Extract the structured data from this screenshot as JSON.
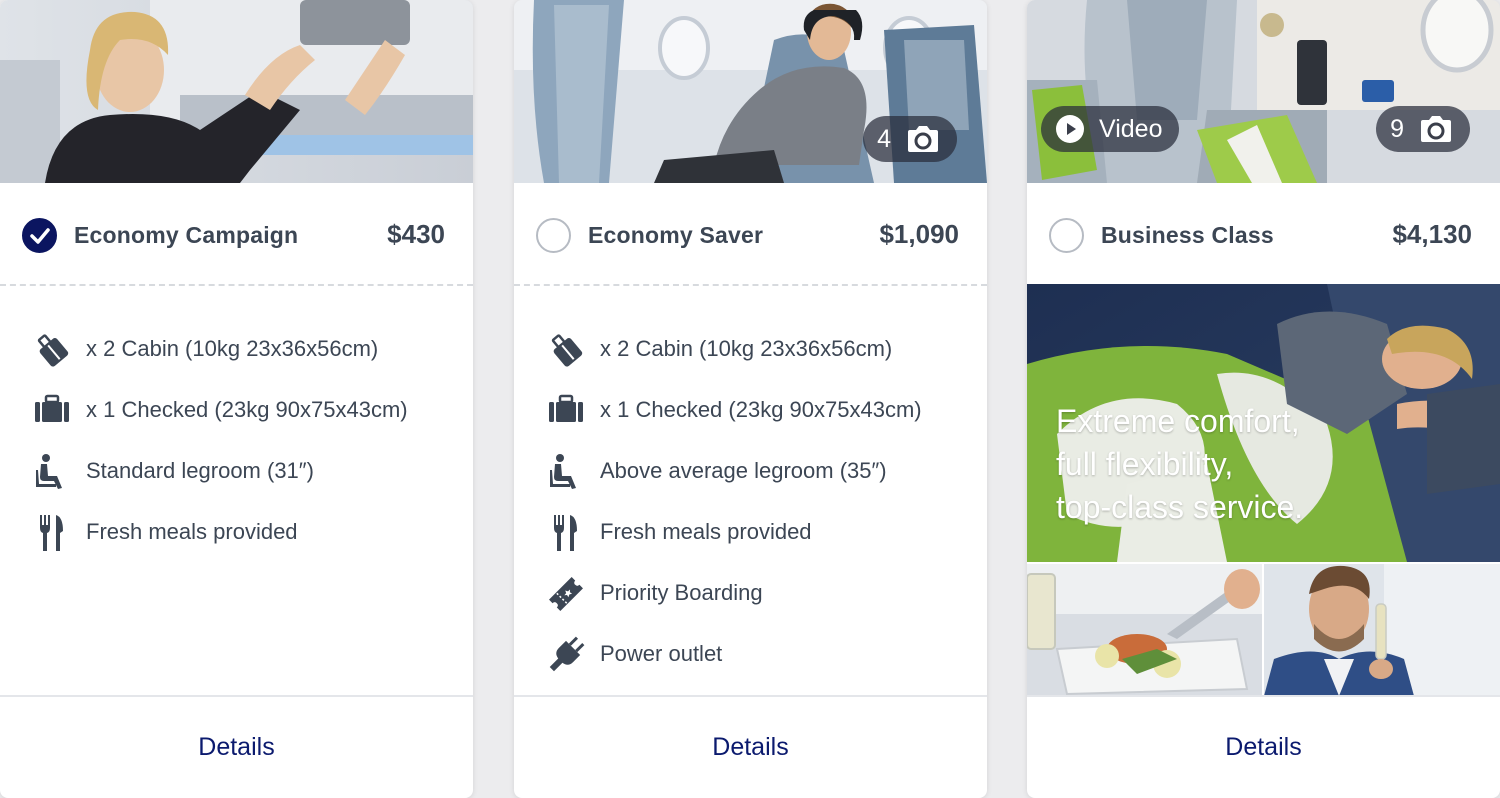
{
  "colors": {
    "navy": "#0b1560",
    "text": "#3c4654",
    "link": "#0b1a6e"
  },
  "cards": [
    {
      "name": "Economy Campaign",
      "price": "$430",
      "selected": true,
      "features": [
        {
          "icon": "cabin-bag-icon",
          "text": "x 2 Cabin (10kg 23x36x56cm)"
        },
        {
          "icon": "checked-bag-icon",
          "text": "x 1 Checked (23kg 90x75x43cm)"
        },
        {
          "icon": "seat-legroom-icon",
          "text": "Standard legroom (31″)"
        },
        {
          "icon": "meal-icon",
          "text": "Fresh meals provided"
        }
      ],
      "details_label": "Details"
    },
    {
      "name": "Economy Saver",
      "price": "$1,090",
      "selected": false,
      "photo_count": "4",
      "features": [
        {
          "icon": "cabin-bag-icon",
          "text": "x 2 Cabin (10kg 23x36x56cm)"
        },
        {
          "icon": "checked-bag-icon",
          "text": "x 1 Checked (23kg 90x75x43cm)"
        },
        {
          "icon": "seat-legroom-icon",
          "text": "Above average legroom (35″)"
        },
        {
          "icon": "meal-icon",
          "text": "Fresh meals provided"
        },
        {
          "icon": "priority-ticket-icon",
          "text": "Priority Boarding"
        },
        {
          "icon": "power-plug-icon",
          "text": "Power outlet"
        }
      ],
      "details_label": "Details"
    },
    {
      "name": "Business Class",
      "price": "$4,130",
      "selected": false,
      "video_label": "Video",
      "photo_count": "9",
      "promo_lines": [
        "Extreme comfort,",
        "full flexibility,",
        "top-class service."
      ],
      "details_label": "Details"
    }
  ]
}
